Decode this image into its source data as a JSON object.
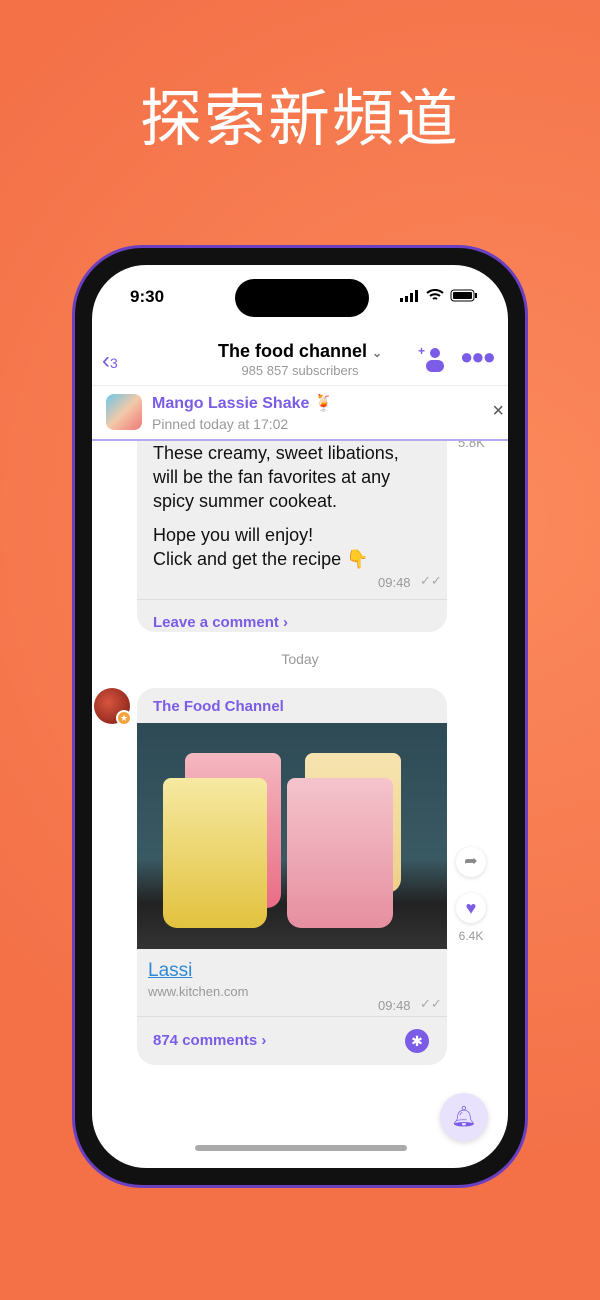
{
  "headline": "探索新頻道",
  "status": {
    "time": "9:30"
  },
  "header": {
    "back_count": "3",
    "title": "The food channel",
    "subtitle": "985 857 subscribers",
    "chevron": "⌄"
  },
  "pinned": {
    "title": "Mango Lassie Shake 🍹",
    "subtitle": "Pinned today at 17:02",
    "close": "×"
  },
  "message1": {
    "lines": [
      "These creamy, sweet libations,",
      "will be the fan favorites at any",
      "spicy summer cookeat.",
      "Hope you will enjoy!",
      "Click and get the recipe 👇"
    ],
    "time": "09:48",
    "views": "5.8K",
    "comment_link": "Leave a comment ›"
  },
  "date_separator": "Today",
  "message2": {
    "sender": "The Food Channel",
    "link_title": "Lassi",
    "link_domain": "www.kitchen.com",
    "time": "09:48",
    "comments": "874 comments ›",
    "likes": "6.4K"
  },
  "colors": {
    "accent": "#7b5ce6",
    "background": "#f47148"
  }
}
